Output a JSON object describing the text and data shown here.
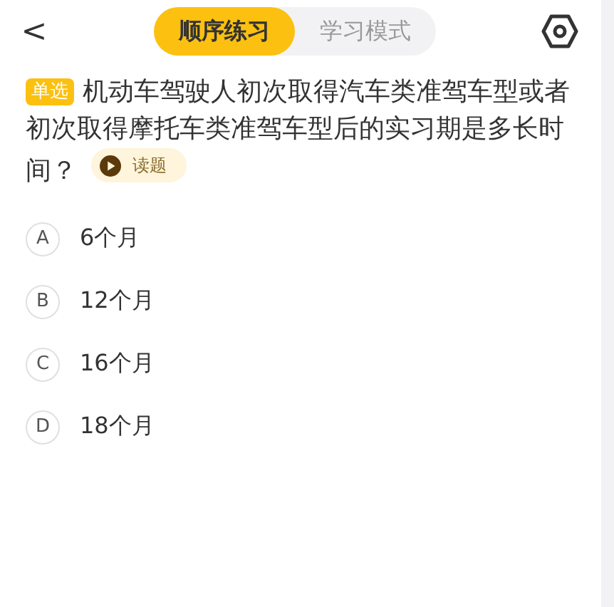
{
  "header": {
    "back": "<",
    "tabs": [
      {
        "label": "顺序练习",
        "selected": true
      },
      {
        "label": "学习模式",
        "selected": false
      }
    ]
  },
  "question": {
    "type_tag": "单选",
    "text": "机动车驾驶人初次取得汽车类准驾车型或者初次取得摩托车类准驾车型后的实习期是多长时间？",
    "read_button": "读题"
  },
  "options": [
    {
      "letter": "A",
      "text": "6个月",
      "selected": false
    },
    {
      "letter": "B",
      "text": "12个月",
      "selected": false
    },
    {
      "letter": "C",
      "text": "16个月",
      "selected": false
    },
    {
      "letter": "D",
      "text": "18个月",
      "selected": false
    }
  ]
}
